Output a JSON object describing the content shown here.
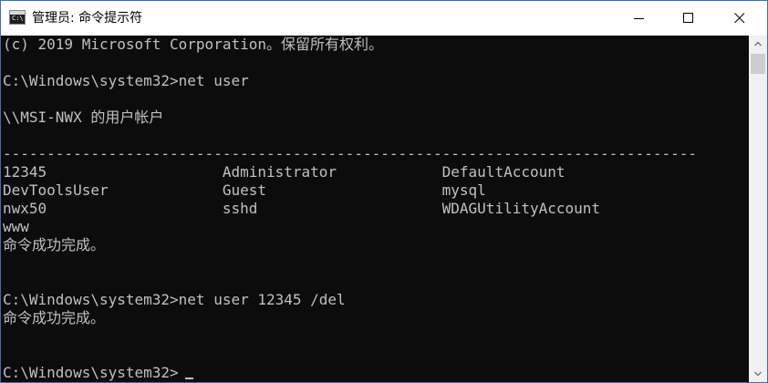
{
  "window": {
    "title": "管理员: 命令提示符",
    "app_icon_text": "C:\\"
  },
  "console": {
    "lines": [
      "(c) 2019 Microsoft Corporation。保留所有权利。",
      "",
      "C:\\Windows\\system32>net user",
      "",
      "\\\\MSI-NWX 的用户帐户",
      "",
      "-------------------------------------------------------------------------------",
      "12345                    Administrator            DefaultAccount",
      "DevToolsUser             Guest                    mysql",
      "nwx50                    sshd                     WDAGUtilityAccount",
      "www",
      "命令成功完成。",
      "",
      "",
      "C:\\Windows\\system32>net user 12345 /del",
      "命令成功完成。",
      "",
      "",
      "C:\\Windows\\system32>"
    ]
  },
  "icons": {
    "minimize": "minimize-icon",
    "maximize": "maximize-icon",
    "close": "close-icon",
    "scroll_up": "chevron-up-icon",
    "scroll_down": "chevron-down-icon"
  },
  "colors": {
    "console_background": "#0c0c0c",
    "console_text": "#c0c0c0",
    "titlebar_background": "#ffffff",
    "window_border": "#3c6fb5"
  }
}
